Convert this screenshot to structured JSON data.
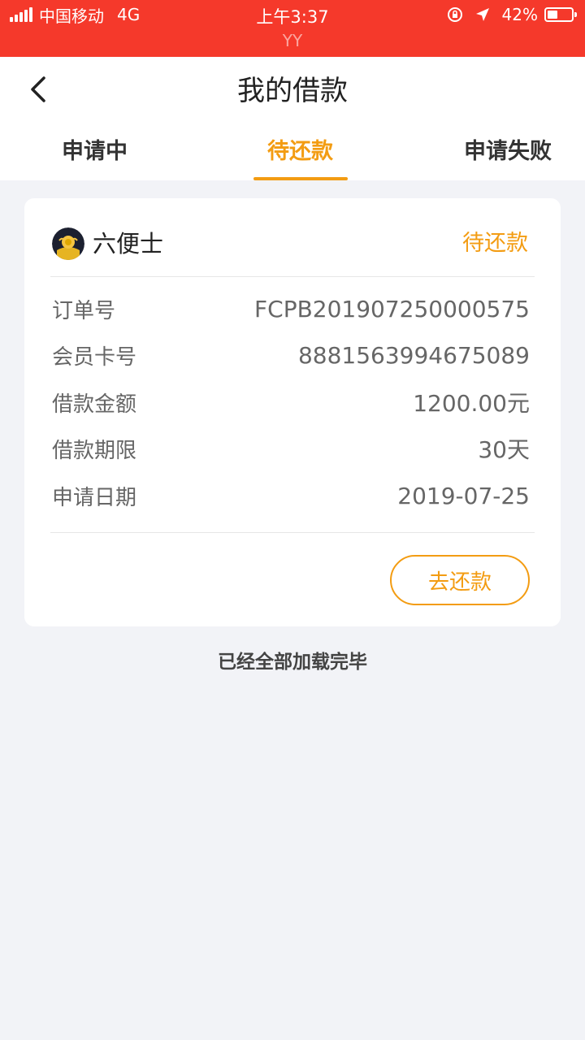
{
  "status_bar": {
    "carrier": "中国移动",
    "network": "4G",
    "time": "上午3:37",
    "sub_label": "YY",
    "battery_text": "42%",
    "battery_level": 0.42
  },
  "header": {
    "title": "我的借款",
    "tabs": [
      {
        "label": "申请中",
        "active": false
      },
      {
        "label": "待还款",
        "active": true
      },
      {
        "label": "申请失败",
        "active": false
      }
    ]
  },
  "loan_card": {
    "lender_name": "六便士",
    "status": "待还款",
    "rows": [
      {
        "label": "订单号",
        "value": "FCPB201907250000575"
      },
      {
        "label": "会员卡号",
        "value": "8881563994675089"
      },
      {
        "label": "借款金额",
        "value": "1200.00元"
      },
      {
        "label": "借款期限",
        "value": "30天"
      },
      {
        "label": "申请日期",
        "value": "2019-07-25"
      }
    ],
    "repay_button": "去还款"
  },
  "footer_note": "已经全部加载完毕",
  "colors": {
    "status_bar_bg": "#f5392b",
    "accent": "#f39c12",
    "page_bg": "#f2f3f7"
  }
}
